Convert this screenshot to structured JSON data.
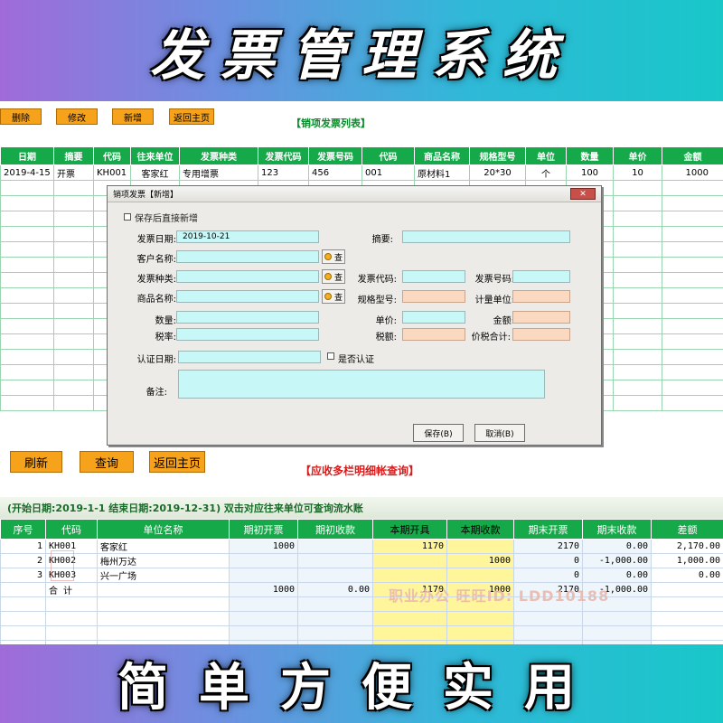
{
  "banner_top": "发票管理系统",
  "banner_bottom": "简单方便实用",
  "toolbar": {
    "delete": "删除",
    "edit": "修改",
    "add": "新增",
    "home": "返回主页"
  },
  "sales_list": {
    "title": "【销项发票列表】",
    "columns": [
      "日期",
      "摘要",
      "代码",
      "往来单位",
      "发票种类",
      "发票代码",
      "发票号码",
      "代码",
      "商品名称",
      "规格型号",
      "单位",
      "数量",
      "单价",
      "金额"
    ],
    "row": [
      "2019-4-15",
      "开票",
      "KH001",
      "客家红",
      "专用增票",
      "123",
      "456",
      "001",
      "原材料1",
      "20*30",
      "个",
      "100",
      "10",
      "1000"
    ]
  },
  "dialog": {
    "title": "销项发票【新增】",
    "close": "✕",
    "keep_adding": "保存后直接新增",
    "invoice_date_label": "发票日期:",
    "invoice_date_value": "2019-10-21",
    "summary_label": "摘要:",
    "customer_label": "客户名称:",
    "invoice_type_label": "发票种类:",
    "invoice_code_label": "发票代码:",
    "invoice_no_label": "发票号码:",
    "product_label": "商品名称:",
    "spec_label": "规格型号:",
    "unit_label": "计量单位:",
    "qty_label": "数量:",
    "price_label": "单价:",
    "amount_label": "金额:",
    "tax_rate_label": "税率:",
    "tax_label": "税额:",
    "total_label": "价税合计:",
    "auth_date_label": "认证日期:",
    "is_auth_label": "是否认证",
    "memo_label": "备注:",
    "query_btn": "查",
    "save": "保存(B)",
    "cancel": "取消(B)"
  },
  "toolbar2": {
    "refresh": "刷新",
    "query": "查询",
    "home": "返回主页"
  },
  "ledger": {
    "title": "【应收多栏明细帐查询】",
    "filter": "(开始日期:2019-1-1  结束日期:2019-12-31)  双击对应往来单位可查询流水账",
    "columns": [
      "序号",
      "代码",
      "单位名称",
      "期初开票",
      "期初收款",
      "本期开具",
      "本期收款",
      "期末开票",
      "期末收款",
      "差额"
    ],
    "rows": [
      [
        "1",
        "KH001",
        "客家红",
        "1000",
        "",
        "1170",
        "",
        "2170",
        "0.00",
        "2,170.00"
      ],
      [
        "2",
        "KH002",
        "梅州万达",
        "",
        "",
        "",
        "1000",
        "0",
        "-1,000.00",
        "1,000.00"
      ],
      [
        "3",
        "KH003",
        "兴一广场",
        "",
        "",
        "",
        "",
        "0",
        "0.00",
        "0.00"
      ]
    ],
    "total": [
      "",
      "合  计",
      "",
      "1000",
      "0.00",
      "1170",
      "1000",
      "2170",
      "-1,000.00",
      ""
    ]
  },
  "watermark": "职业办公 旺旺ID: LDD10188"
}
